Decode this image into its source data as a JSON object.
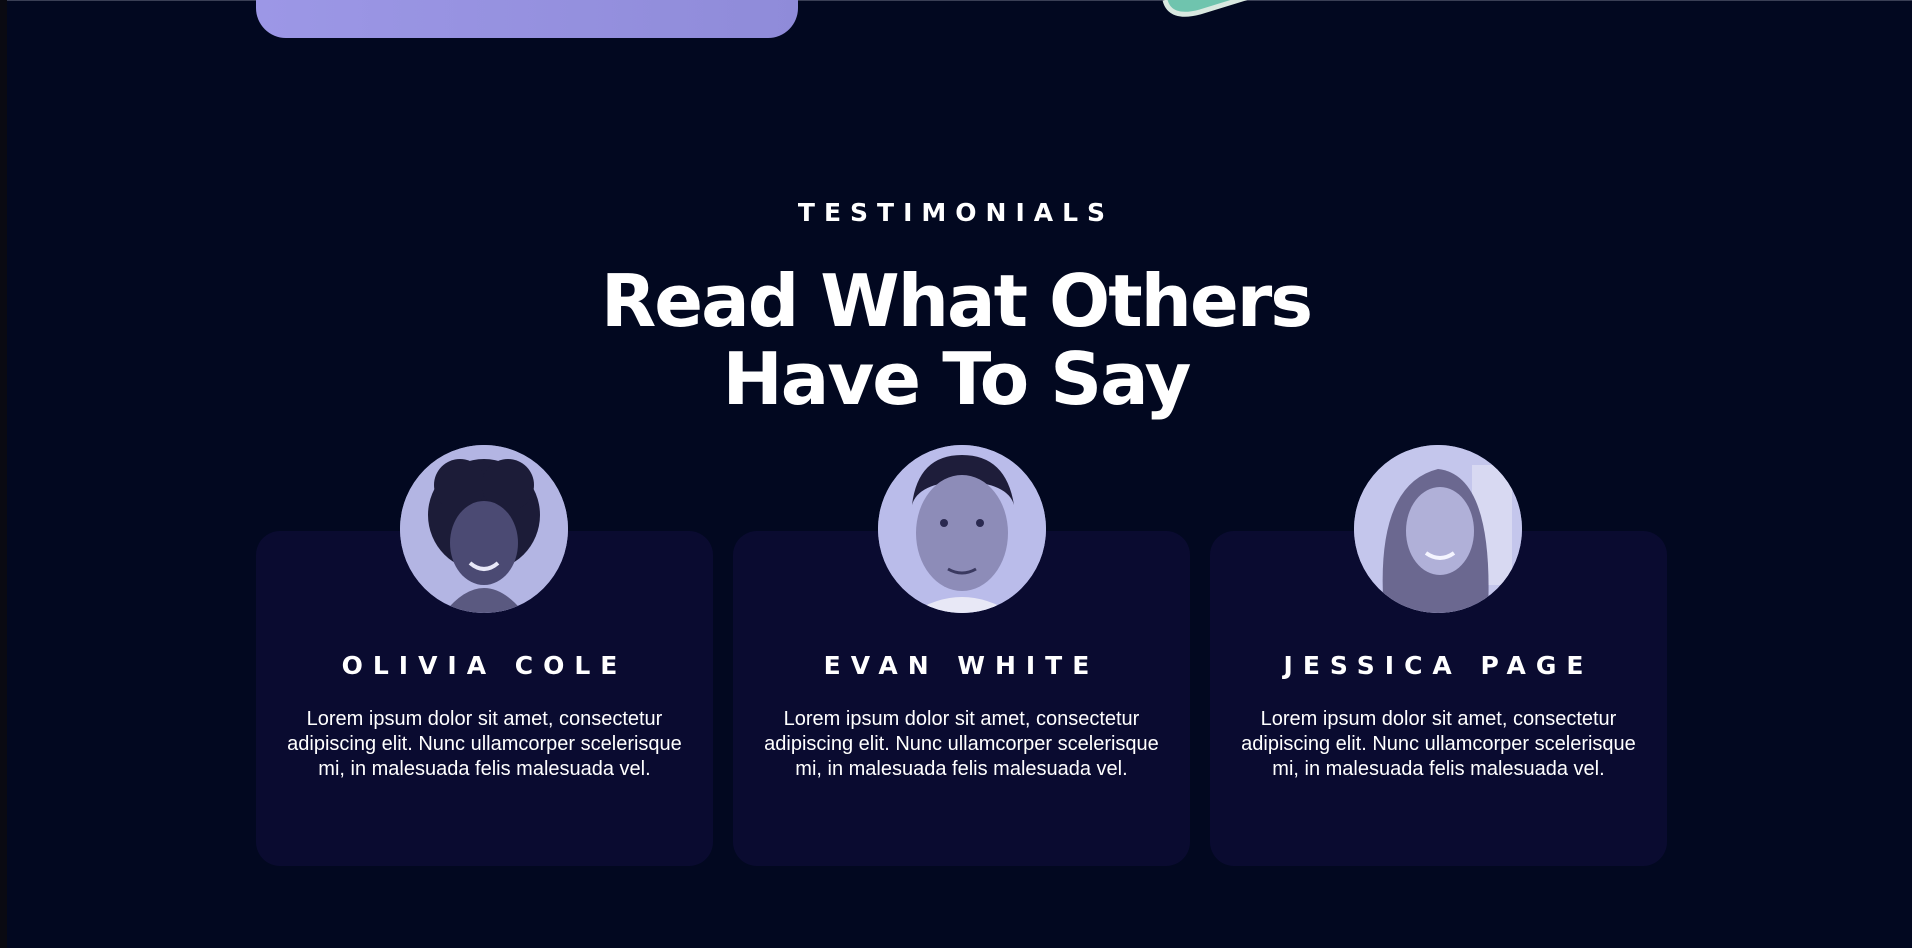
{
  "section": {
    "eyebrow": "TESTIMONIALS",
    "headline_line1": "Read What Others",
    "headline_line2": "Have To Say"
  },
  "testimonials": [
    {
      "name": "OLIVIA COLE",
      "quote": "Lorem ipsum dolor sit amet, consectetur adipiscing elit. Nunc ullamcorper scelerisque mi, in malesuada felis malesuada vel."
    },
    {
      "name": "EVAN WHITE",
      "quote": "Lorem ipsum dolor sit amet, consectetur adipiscing elit. Nunc ullamcorper scelerisque mi, in malesuada felis malesuada vel."
    },
    {
      "name": "JESSICA PAGE",
      "quote": "Lorem ipsum dolor sit amet, consectetur adipiscing elit. Nunc ullamcorper scelerisque mi, in malesuada felis malesuada vel."
    }
  ],
  "colors": {
    "background": "#020820",
    "card": "#0a0b30",
    "accent": "#9c97e6",
    "avatar_tint": "#aeb0e0"
  }
}
